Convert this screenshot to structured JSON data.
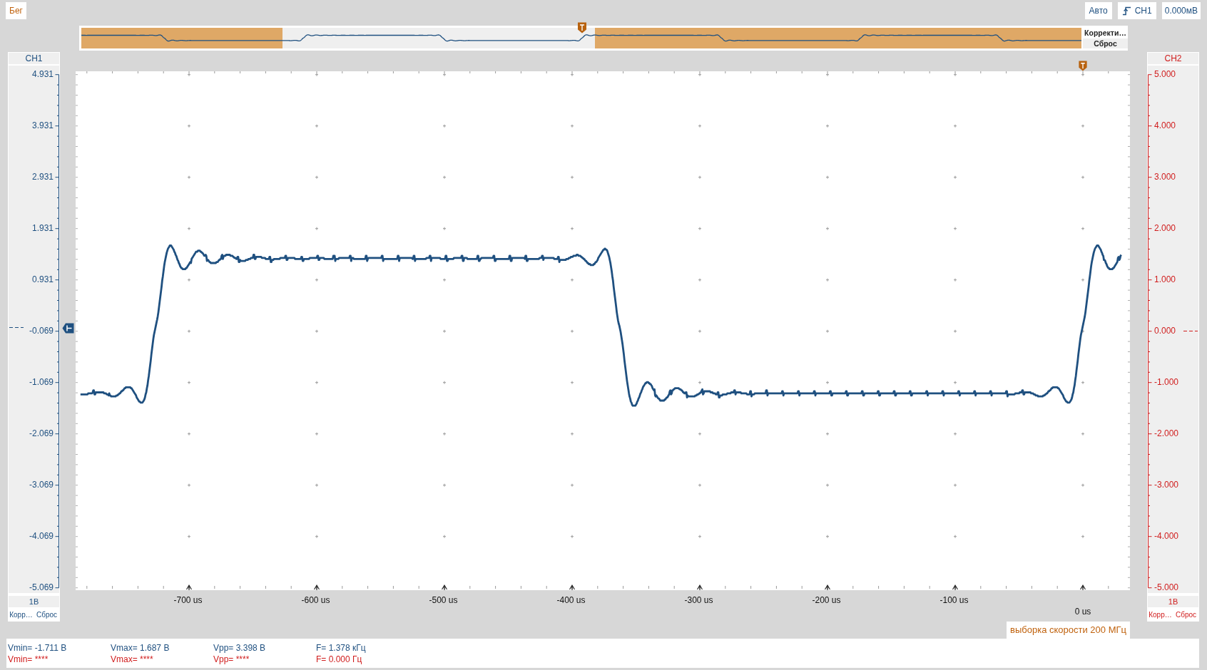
{
  "toolbar": {
    "run_button": "Бег",
    "trigger_mode": "Авто",
    "trigger_source": "CH1",
    "trigger_level": "0.000мВ"
  },
  "overview": {
    "buttons": [
      "Корректи…",
      "Сброс"
    ]
  },
  "channels": [
    {
      "name": "CH1",
      "color": "#1f5080",
      "ticks": [
        "4.931",
        "3.931",
        "2.931",
        "1.931",
        "0.931",
        "-0.069",
        "-1.069",
        "-2.069",
        "-3.069",
        "-4.069",
        "-5.069"
      ],
      "scale": "1В",
      "buttons": [
        "Корр…",
        "Сброс"
      ],
      "measurements": [
        "Vmin= -1.711 В",
        "Vmax= 1.687 В",
        "Vpp= 3.398 В",
        "F= 1.378 кГц"
      ]
    },
    {
      "name": "CH2",
      "color": "#d01c1c",
      "ticks": [
        "5.000",
        "4.000",
        "3.000",
        "2.000",
        "1.000",
        "0.000",
        "-1.000",
        "-2.000",
        "-3.000",
        "-4.000",
        "-5.000"
      ],
      "scale": "1В",
      "buttons": [
        "Корр…",
        "Сброс"
      ],
      "measurements": [
        "Vmin= ****",
        "Vmax= ****",
        "Vpp= ****",
        "F= 0.000 Гц"
      ]
    }
  ],
  "x_axis": {
    "ticks": [
      "-700 us",
      "-600 us",
      "-500 us",
      "-400 us",
      "-300 us",
      "-200 us",
      "-100 us",
      "0 us"
    ]
  },
  "sample_rate": "выборка скорости 200 МГц"
}
